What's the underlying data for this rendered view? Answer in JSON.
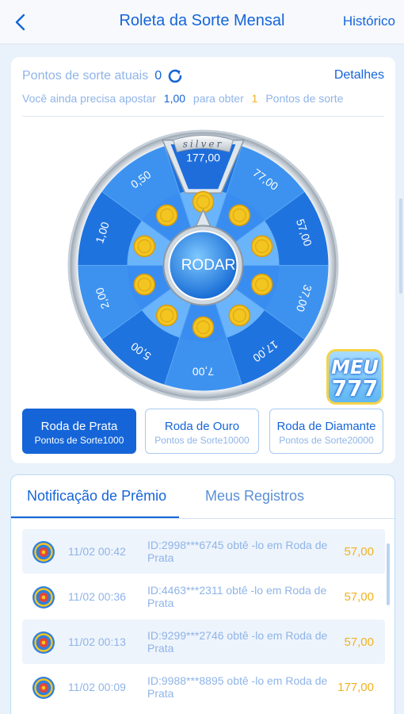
{
  "header": {
    "title": "Roleta da Sorte Mensal",
    "history_label": "Histórico"
  },
  "points": {
    "label": "Pontos de sorte atuais",
    "value": "0",
    "details_label": "Detalhes",
    "need_prefix": "Você ainda precisa apostar",
    "need_amount": "1,00",
    "need_middle": "para obter",
    "need_count": "1",
    "need_suffix": "Pontos de sorte"
  },
  "wheel": {
    "badge": "silver",
    "top_value": "177,00",
    "spin_label": "RODAR",
    "segments": [
      "177,00",
      "77,00",
      "57,00",
      "37,00",
      "17,00",
      "7,00",
      "5,00",
      "2,00",
      "1,00",
      "0,50"
    ],
    "colors": {
      "dark": "#1f73de",
      "light": "#3d92ef",
      "inner_dark": "#3a8df0",
      "inner_light": "#69b4fb",
      "coin": "#f3c521"
    }
  },
  "logo": {
    "line1": "MEU",
    "line2": "777"
  },
  "tiers": [
    {
      "name": "Roda de Prata",
      "requirement": "Pontos de Sorte1000",
      "active": true
    },
    {
      "name": "Roda de Ouro",
      "requirement": "Pontos de Sorte10000",
      "active": false
    },
    {
      "name": "Roda de Diamante",
      "requirement": "Pontos de Sorte20000",
      "active": false
    }
  ],
  "tabs": {
    "prizes": "Notificação de Prêmio",
    "records": "Meus Registros"
  },
  "notifications": [
    {
      "time": "11/02 00:42",
      "desc": "ID:2998***6745 obtê -lo em Roda de Prata",
      "prize": "57,00"
    },
    {
      "time": "11/02 00:36",
      "desc": "ID:4463***2311 obtê -lo em Roda de Prata",
      "prize": "57,00"
    },
    {
      "time": "11/02 00:13",
      "desc": "ID:9299***2746 obtê -lo em Roda de Prata",
      "prize": "57,00"
    },
    {
      "time": "11/02 00:09",
      "desc": "ID:9988***8895 obtê -lo em Roda de Prata",
      "prize": "177,00"
    }
  ]
}
